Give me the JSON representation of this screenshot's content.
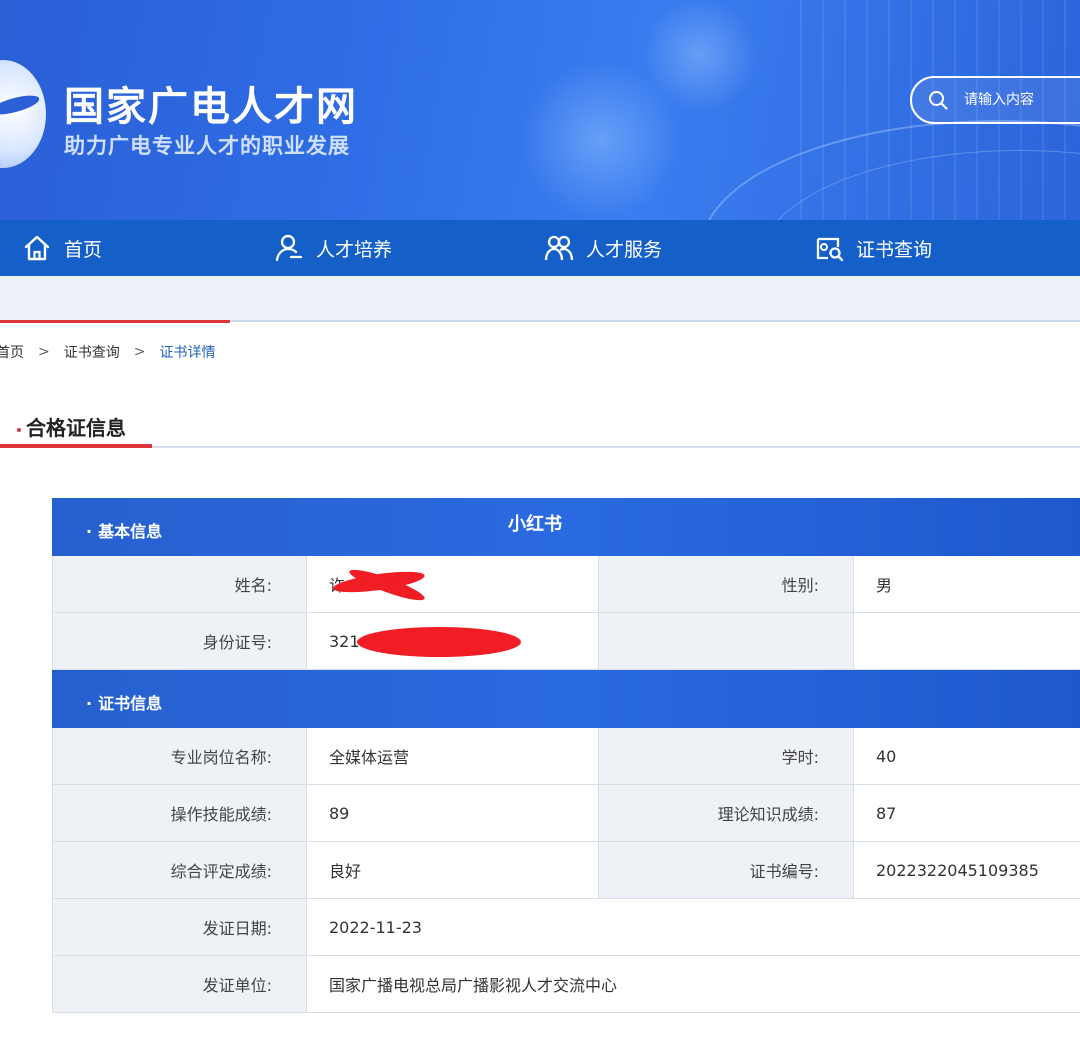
{
  "header": {
    "site_title": "国家广电人才网",
    "site_subtitle": "助力广电专业人才的职业发展",
    "search_placeholder": "请输入内容"
  },
  "nav": {
    "items": [
      {
        "label": "首页",
        "icon": "home-icon"
      },
      {
        "label": "人才培养",
        "icon": "user-icon"
      },
      {
        "label": "人才服务",
        "icon": "users-icon"
      },
      {
        "label": "证书查询",
        "icon": "certificate-search-icon"
      }
    ]
  },
  "breadcrumb": {
    "items": [
      "首页",
      "证书查询",
      "证书详情"
    ],
    "separator": ">"
  },
  "section": {
    "title": "合格证信息"
  },
  "watermark": "小红书",
  "basic_info": {
    "header": "基本信息",
    "name_label": "姓名:",
    "name_value": "许",
    "gender_label": "性别:",
    "gender_value": "男",
    "id_label": "身份证号:",
    "id_value": "321"
  },
  "cert_info": {
    "header": "证书信息",
    "position_label": "专业岗位名称:",
    "position_value": "全媒体运营",
    "hours_label": "学时:",
    "hours_value": "40",
    "skill_label": "操作技能成绩:",
    "skill_value": "89",
    "theory_label": "理论知识成绩:",
    "theory_value": "87",
    "overall_label": "综合评定成绩:",
    "overall_value": "良好",
    "cert_no_label": "证书编号:",
    "cert_no_value": "2022322045109385",
    "issue_date_label": "发证日期:",
    "issue_date_value": "2022-11-23",
    "issuer_label": "发证单位:",
    "issuer_value": "国家广播电视总局广播影视人才交流中心"
  },
  "colors": {
    "nav_blue": "#1560c8",
    "accent_red": "#e0353b",
    "redaction_red": "#f01d24"
  }
}
